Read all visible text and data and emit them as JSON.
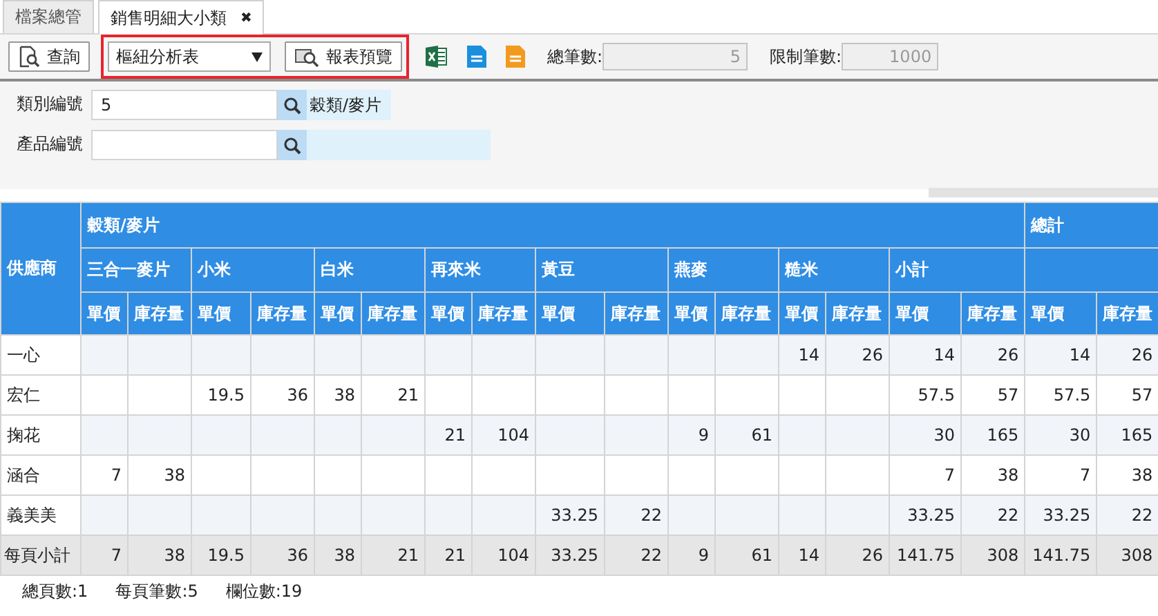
{
  "tabs": [
    {
      "label": "檔案總管",
      "selected": false
    },
    {
      "label": "銷售明細大小類",
      "selected": true,
      "close": "✖"
    }
  ],
  "toolbar": {
    "query_button": "查詢",
    "report_group": {
      "highlighted": true,
      "select": {
        "value": "樞紐分析表"
      },
      "preview_button": "報表預覽"
    },
    "fields": [
      {
        "label": "總筆數:",
        "value": "5",
        "disabled": true
      },
      {
        "label": "限制筆數:",
        "value": "1000",
        "disabled": true
      }
    ]
  },
  "filters": [
    {
      "label": "類別編號",
      "value": "5",
      "description": "穀類/麥片"
    },
    {
      "label": "產品編號"
    }
  ],
  "table": {
    "supplier_header": "供應商",
    "category": "穀類/麥片",
    "total_header": "總計",
    "groups": [
      {
        "name": "三合一麥片",
        "columns": [
          "單價",
          "庫存量"
        ]
      },
      {
        "name": "小米",
        "columns": [
          "單價",
          "庫存量"
        ]
      },
      {
        "name": "白米",
        "columns": [
          "單價",
          "庫存量"
        ]
      },
      {
        "name": "再來米",
        "columns": [
          "單價",
          "庫存量"
        ]
      },
      {
        "name": "黃豆",
        "columns": [
          "單價",
          "庫存量"
        ]
      },
      {
        "name": "燕麥",
        "columns": [
          "單價",
          "庫存量"
        ]
      },
      {
        "name": "糙米",
        "columns": [
          "單價",
          "庫存量"
        ]
      },
      {
        "name": "小計",
        "columns": [
          "單價",
          "庫存量"
        ]
      }
    ],
    "total_columns": [
      "單價",
      "庫存量"
    ],
    "rows": [
      {
        "supplier": "一心",
        "cells": [
          null,
          null,
          null,
          null,
          null,
          null,
          null,
          null,
          null,
          null,
          null,
          null,
          "14",
          "26",
          "14",
          "26",
          "14",
          "26"
        ]
      },
      {
        "supplier": "宏仁",
        "cells": [
          null,
          null,
          "19.5",
          "36",
          "38",
          "21",
          null,
          null,
          null,
          null,
          null,
          null,
          null,
          null,
          "57.5",
          "57",
          "57.5",
          "57"
        ]
      },
      {
        "supplier": "掬花",
        "cells": [
          null,
          null,
          null,
          null,
          null,
          null,
          "21",
          "104",
          null,
          null,
          "9",
          "61",
          null,
          null,
          "30",
          "165",
          "30",
          "165"
        ]
      },
      {
        "supplier": "涵合",
        "cells": [
          "7",
          "38",
          null,
          null,
          null,
          null,
          null,
          null,
          null,
          null,
          null,
          null,
          null,
          null,
          "7",
          "38",
          "7",
          "38"
        ]
      },
      {
        "supplier": "義美美",
        "cells": [
          null,
          null,
          null,
          null,
          null,
          null,
          null,
          null,
          "33.25",
          "22",
          null,
          null,
          null,
          null,
          "33.25",
          "22",
          "33.25",
          "22"
        ]
      }
    ],
    "footer": {
      "label": "每頁小計",
      "cells": [
        "7",
        "38",
        "19.5",
        "36",
        "38",
        "21",
        "21",
        "104",
        "33.25",
        "22",
        "9",
        "61",
        "14",
        "26",
        "141.75",
        "308",
        "141.75",
        "308"
      ]
    }
  },
  "status_bar": [
    "總頁數:1",
    "每頁筆數:5",
    "欄位數:19"
  ]
}
